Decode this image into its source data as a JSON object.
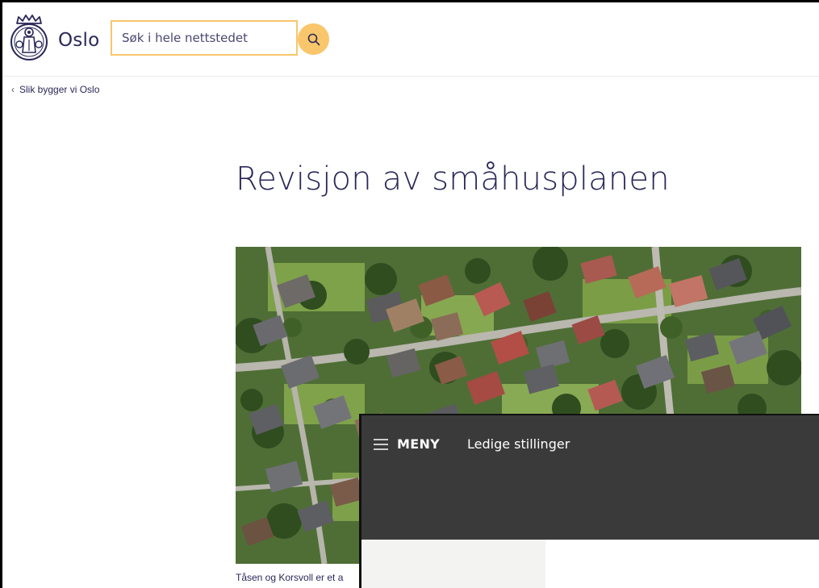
{
  "header": {
    "brand": "Oslo",
    "search_placeholder": "Søk i hele nettstedet"
  },
  "breadcrumb": {
    "label": "Slik bygger vi Oslo"
  },
  "main": {
    "title": "Revisjon av småhusplanen",
    "caption": "Tåsen og Korsvoll er et a"
  },
  "overlay": {
    "menu_label": "MENY",
    "nav_link": "Ledige stillinger"
  },
  "colors": {
    "brand": "#2a2859",
    "accent": "#f9c66b",
    "overlay_bg": "#3a3a3a"
  },
  "icons": {
    "logo": "oslo-city-seal-icon",
    "search": "search-icon",
    "breadcrumb": "chevron-left-icon",
    "menu": "hamburger-icon"
  }
}
